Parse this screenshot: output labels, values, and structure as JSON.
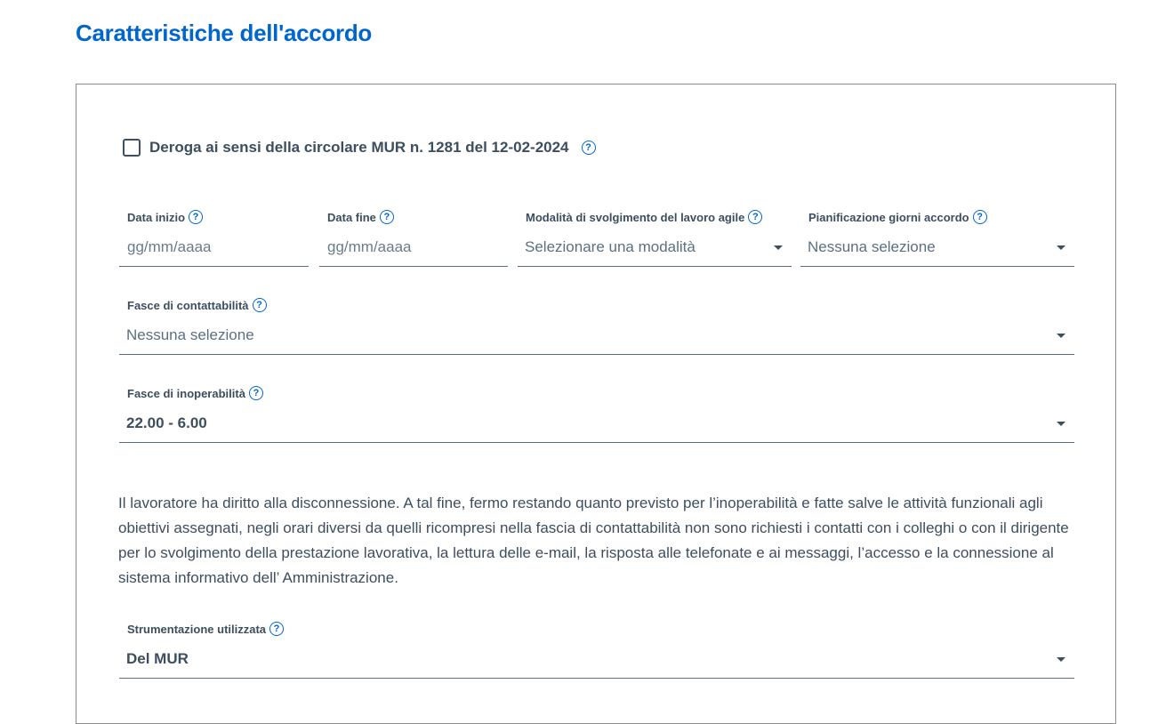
{
  "page": {
    "title": "Caratteristiche dell'accordo"
  },
  "deroga": {
    "label": "Deroga ai sensi della circolare MUR n. 1281 del 12-02-2024",
    "checked": false
  },
  "fields": {
    "data_inizio": {
      "label": "Data inizio",
      "placeholder": "gg/mm/aaaa"
    },
    "data_fine": {
      "label": "Data fine",
      "placeholder": "gg/mm/aaaa"
    },
    "modalita": {
      "label": "Modalità di svolgimento del lavoro agile",
      "value": "Selezionare una modalità"
    },
    "pianificazione": {
      "label": "Pianificazione giorni accordo",
      "value": "Nessuna selezione"
    },
    "contattabilita": {
      "label": "Fasce di contattabilità",
      "value": "Nessuna selezione"
    },
    "inoperabilita": {
      "label": "Fasce di inoperabilità",
      "value": "22.00 - 6.00"
    },
    "strumentazione": {
      "label": "Strumentazione utilizzata",
      "value": "Del MUR"
    }
  },
  "notice": "Il lavoratore ha diritto alla disconnessione. A tal fine, fermo restando quanto previsto per l’inoperabilità e fatte salve le attività funzionali agli obiettivi assegnati, negli orari diversi da quelli ricompresi nella fascia di contattabilità non sono richiesti i contatti con i colleghi o con il dirigente per lo svolgimento della prestazione lavorativa, la lettura delle e-mail, la risposta alle telefonate e ai messaggi, l’accesso e la connessione al sistema informativo dell’ Amministrazione.",
  "icons": {
    "help": "question-circle-icon",
    "caret": "caret-down-icon",
    "help_glyph": "?"
  },
  "colors": {
    "title": "#0066cc",
    "help_icon": "#0066cc",
    "text": "#3d4e5f"
  }
}
